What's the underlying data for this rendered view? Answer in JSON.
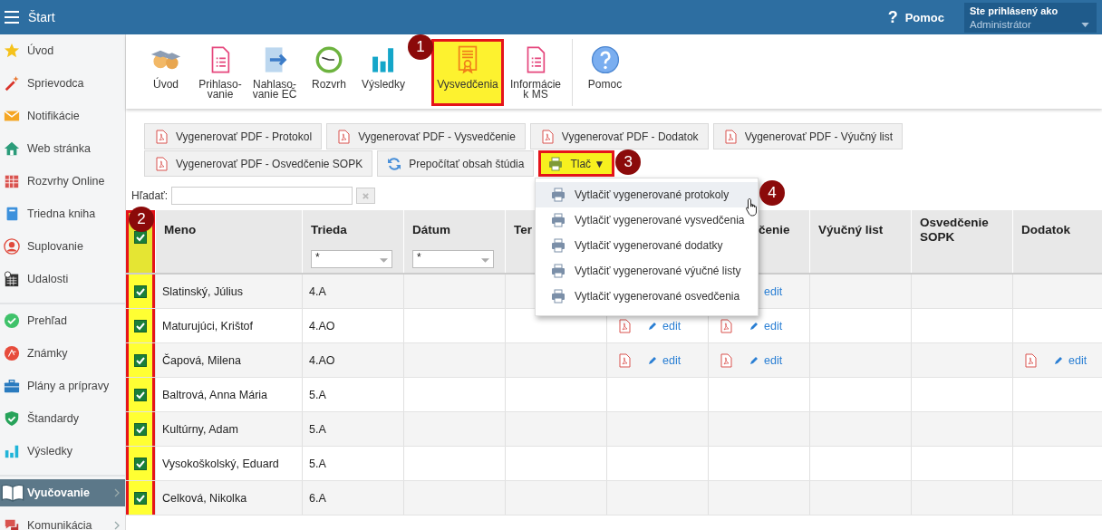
{
  "header": {
    "title": "Štart",
    "help_glyph": "?",
    "help": "Pomoc",
    "user_caption": "Ste prihlásený ako",
    "user_name": "Administrátor"
  },
  "sidebar": {
    "sections": [
      {
        "items": [
          {
            "label": "Úvod",
            "selected": false,
            "submenu": false
          },
          {
            "label": "Sprievodca",
            "selected": false,
            "submenu": false
          },
          {
            "label": "Notifikácie",
            "selected": false,
            "submenu": false
          },
          {
            "label": "Web stránka",
            "selected": false,
            "submenu": false
          },
          {
            "label": "Rozvrhy Online",
            "selected": false,
            "submenu": false
          },
          {
            "label": "Triedna kniha",
            "selected": false,
            "submenu": false
          },
          {
            "label": "Suplovanie",
            "selected": false,
            "submenu": false
          },
          {
            "label": "Udalosti",
            "selected": false,
            "submenu": false
          }
        ]
      },
      {
        "items": [
          {
            "label": "Prehľad",
            "selected": false,
            "submenu": false
          },
          {
            "label": "Známky",
            "selected": false,
            "submenu": false
          },
          {
            "label": "Plány a prípravy",
            "selected": false,
            "submenu": false
          },
          {
            "label": "Štandardy",
            "selected": false,
            "submenu": false
          },
          {
            "label": "Výsledky",
            "selected": false,
            "submenu": false
          }
        ]
      },
      {
        "items": [
          {
            "label": "Vyučovanie",
            "selected": true,
            "submenu": true
          },
          {
            "label": "Komunikácia",
            "selected": false,
            "submenu": true
          }
        ]
      }
    ]
  },
  "ribbon": {
    "items": [
      {
        "label": "Úvod",
        "highlighted": false,
        "separator_before": false
      },
      {
        "label": "Prihlaso-\nvanie",
        "highlighted": false,
        "separator_before": false
      },
      {
        "label": "Nahlaso-\nvanie EČ",
        "highlighted": false,
        "separator_before": false
      },
      {
        "label": "Rozvrh",
        "highlighted": false,
        "separator_before": false
      },
      {
        "label": "Výsledky",
        "highlighted": false,
        "separator_before": false
      },
      {
        "label": "Vysvedčenia",
        "highlighted": true,
        "separator_before": false,
        "callout": "1"
      },
      {
        "label": "Informácie\nk MS",
        "highlighted": false,
        "separator_before": false
      },
      {
        "label": "Pomoc",
        "highlighted": false,
        "separator_before": true
      }
    ]
  },
  "toolbar": {
    "rows": [
      [
        {
          "label": "Vygenerovať PDF - Protokol",
          "highlighted": false
        },
        {
          "label": "Vygenerovať PDF - Vysvedčenie",
          "highlighted": false
        },
        {
          "label": "Vygenerovať PDF - Dodatok",
          "highlighted": false
        },
        {
          "label": "Vygenerovať PDF - Výučný list",
          "highlighted": false
        }
      ],
      [
        {
          "label": "Vygenerovať PDF - Osvedčenie SOPK",
          "highlighted": false
        },
        {
          "label": "Prepočítať obsah štúdia",
          "highlighted": false
        },
        {
          "label": "Tlač ▼",
          "highlighted": true,
          "callout": "3"
        }
      ]
    ]
  },
  "print_menu": {
    "items": [
      {
        "label": "Vytlačiť vygenerované protokoly",
        "selected": true,
        "callout": "4"
      },
      {
        "label": "Vytlačiť vygenerované vysvedčenia",
        "selected": false
      },
      {
        "label": "Vytlačiť vygenerované dodatky",
        "selected": false
      },
      {
        "label": "Vytlačiť vygenerované výučné listy",
        "selected": false
      },
      {
        "label": "Vytlačiť vygenerované osvedčenia",
        "selected": false
      }
    ]
  },
  "search": {
    "label": "Hľadať:"
  },
  "table": {
    "columns": [
      {
        "kind": "checkbox",
        "checked": true,
        "highlighted": true,
        "callout": "2"
      },
      {
        "kind": "text",
        "label": "Meno"
      },
      {
        "kind": "filter",
        "label": "Trieda",
        "filter": "*"
      },
      {
        "kind": "filter",
        "label": "Dátum",
        "filter": "*"
      },
      {
        "kind": "text",
        "label": "Ter"
      },
      {
        "kind": "blank"
      },
      {
        "kind": "partial",
        "label": "čenie"
      },
      {
        "kind": "text",
        "label": "Výučný list"
      },
      {
        "kind": "text",
        "label": "Osvedčenie SOPK"
      },
      {
        "kind": "text",
        "label": "Dodatok"
      }
    ],
    "rows": [
      {
        "checked": true,
        "name": "Slatinský, Július",
        "class": "4.A",
        "docs": {
          "column_6": {
            "pdf": false,
            "pencil": false,
            "link": "edit"
          }
        }
      },
      {
        "checked": true,
        "name": "Maturujúci, Krištof",
        "class": "4.AO",
        "docs": {
          "column_5": {
            "pdf": true,
            "pencil": true,
            "link": "edit"
          },
          "column_6": {
            "pdf": true,
            "pencil": true,
            "link": "edit"
          }
        }
      },
      {
        "checked": true,
        "name": "Čapová, Milena",
        "class": "4.AO",
        "docs": {
          "column_5": {
            "pdf": true,
            "pencil": true,
            "link": "edit"
          },
          "column_6": {
            "pdf": true,
            "pencil": true,
            "link": "edit"
          },
          "dodatok": {
            "pdf": true,
            "pencil": true,
            "link": "edit"
          }
        }
      },
      {
        "checked": true,
        "name": "Baltrová, Anna Mária",
        "class": "5.A"
      },
      {
        "checked": true,
        "name": "Kultúrny, Adam",
        "class": "5.A"
      },
      {
        "checked": true,
        "name": "Vysokoškolský, Eduard",
        "class": "5.A"
      },
      {
        "checked": true,
        "name": "Celková, Nikolka",
        "class": "6.A"
      }
    ]
  }
}
